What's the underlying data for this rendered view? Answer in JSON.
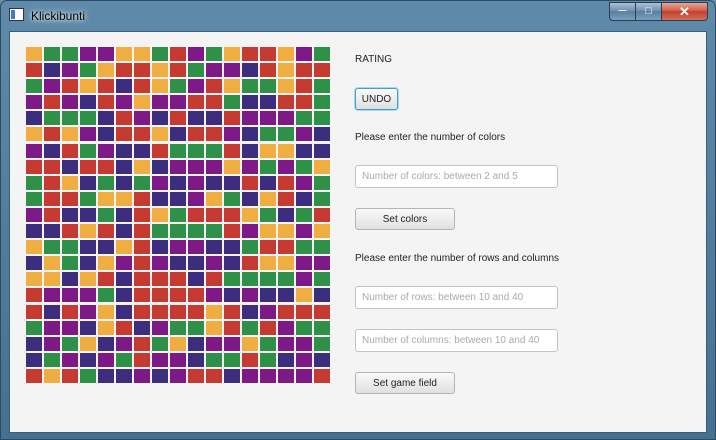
{
  "window": {
    "title": "Klickibunti"
  },
  "palette": {
    "Y": "#f0ad42",
    "G": "#2f9147",
    "P": "#7e1a87",
    "R": "#c53b32",
    "N": "#3d2d7e"
  },
  "board": [
    "YGGPPYYGRPGYRRYPG",
    "RNPGYRRYRGPPNRYRR",
    "GPRYRNRYGPRYGGYRG",
    "PRPNRPYPPRRGNNRRG",
    "NGGGNRPNRNNRPPPGG",
    "YRYPNRRYNRRPNGGPN",
    "PNRGPNNRGGGRNYYNN",
    "RRNRRNYNPPPYPGPGY",
    "GRYNGNGPNPNNRNRPG",
    "GRRGYYRNNPYGNYRNG",
    "PRNNGNRYGRRRYGNGR",
    "NNRYRNRGGGGRPYYPY",
    "YGGNNYRNPPNNGRRGG",
    "NYGNYPRPNNPNRYYPP",
    "YYNYRNRRRNRGGGGPG",
    "RPPPGNRRRRPNPNNYN",
    "RNRPYNRRRRYRNPRRR",
    "GPPNYRNPGGYRGRPGG",
    "NPGYNPRGYNPPYGPPG",
    "NGPNPGRPPNGGRGNPN",
    "RYRGNNPNPRRNPPPPR"
  ],
  "panel": {
    "rating_label": "RATING",
    "undo_label": "UNDO",
    "colors_prompt": "Please enter the number of colors",
    "colors_placeholder": "Number of colors: between 2 and 5",
    "set_colors_label": "Set colors",
    "rows_cols_prompt": "Please enter the number of rows and columns",
    "rows_placeholder": "Number of rows: between 10 and 40",
    "cols_placeholder": "Number of columns: between 10 and 40",
    "set_field_label": "Set game field"
  }
}
